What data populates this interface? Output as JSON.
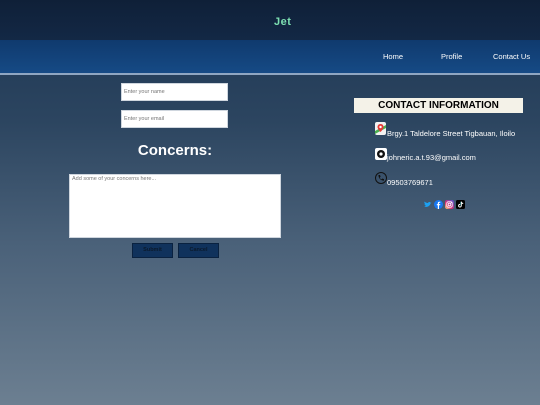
{
  "brand": {
    "logo_text": "Jet"
  },
  "nav": {
    "items": [
      {
        "label": "Home"
      },
      {
        "label": "Profile"
      },
      {
        "label": "Contact Us"
      }
    ]
  },
  "form": {
    "name_placeholder": "Enter your name",
    "email_placeholder": "Enter your email",
    "concerns_title": "Concerns:",
    "concerns_placeholder": "Add some of your concerns here...",
    "submit_label": "Submit",
    "cancel_label": "Cancel"
  },
  "contact": {
    "header": "CONTACT INFORMATION",
    "address": "Brgy.1 Taldelore Street Tigbauan, Iloilo",
    "email": "johneric.a.t.93@gmail.com",
    "phone": "09503769671",
    "socials": [
      {
        "icon": "twitter-icon"
      },
      {
        "icon": "facebook-icon"
      },
      {
        "icon": "instagram-icon"
      },
      {
        "icon": "tiktok-icon"
      }
    ]
  },
  "colors": {
    "accent_logo": "#7de0b2",
    "nav_bg": "#164a85",
    "button_bg": "#10325c"
  }
}
